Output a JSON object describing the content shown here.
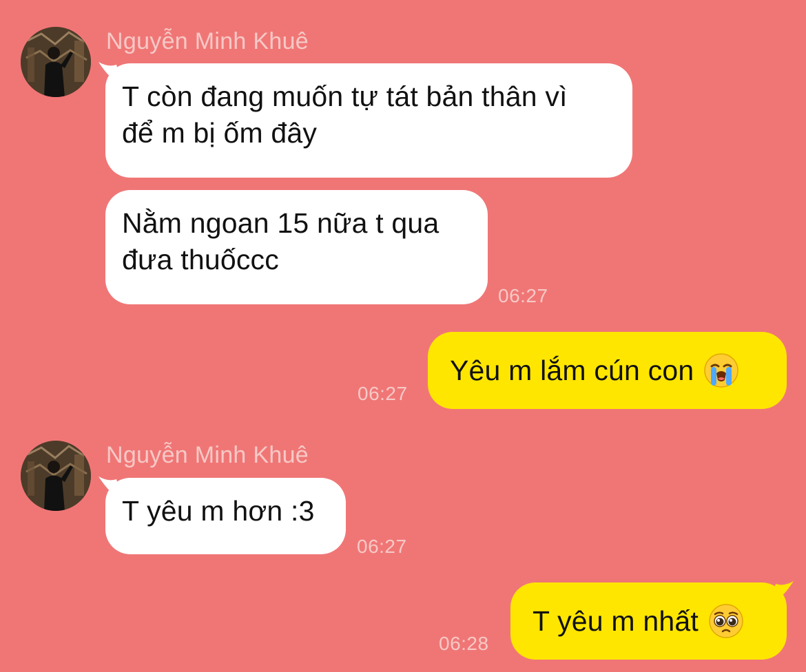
{
  "chat": {
    "contact_name": "Nguyễn Minh Khuê",
    "colors": {
      "background": "#f07676",
      "incoming_bubble": "#ffffff",
      "outgoing_bubble": "#ffe600",
      "meta_text": "#f6c9c6"
    },
    "group1": {
      "sender": "Nguyễn Minh Khuê",
      "msg1": {
        "line1": "T còn đang muốn tự tát bản thân vì",
        "line2": "để m bị ốm đây"
      },
      "msg2": {
        "line1": "Nằm ngoan 15 nữa t qua",
        "line2": "đưa thuốccc",
        "time": "06:27"
      }
    },
    "out1": {
      "text": "Yêu m lắm cún con",
      "emoji": "loudly-crying-face-icon",
      "time": "06:27"
    },
    "group2": {
      "sender": "Nguyễn Minh Khuê",
      "msg1": {
        "text": "T yêu m hơn :3",
        "time": "06:27"
      }
    },
    "out2": {
      "text": "T yêu m nhất",
      "emoji": "pleading-face-icon",
      "time": "06:28"
    }
  }
}
